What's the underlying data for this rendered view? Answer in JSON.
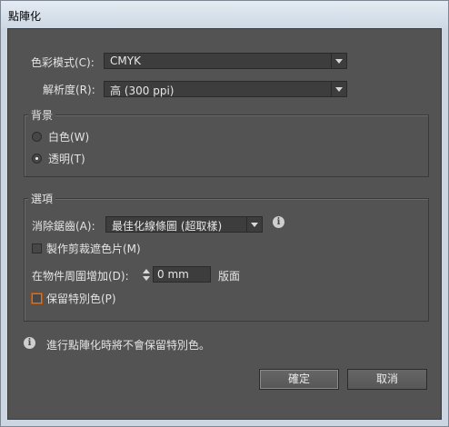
{
  "window": {
    "title": "點陣化"
  },
  "color_mode": {
    "label": "色彩模式(C):",
    "value": "CMYK"
  },
  "resolution": {
    "label": "解析度(R):",
    "value": "高 (300 ppi)"
  },
  "background": {
    "group_title": "背景",
    "options": [
      {
        "label": "白色(W)",
        "selected": false
      },
      {
        "label": "透明(T)",
        "selected": true
      }
    ]
  },
  "options_group": {
    "group_title": "選項",
    "antialias": {
      "label": "消除鋸齒(A):",
      "value": "最佳化線條圖 (超取樣)"
    },
    "clipping_mask": {
      "label": "製作剪裁遮色片(M)",
      "checked": false
    },
    "add_around": {
      "label": "在物件周圍增加(D):",
      "value": "0 mm",
      "unit": "版面"
    },
    "preserve_spot": {
      "label": "保留特別色(P)",
      "checked": false
    }
  },
  "info_message": "進行點陣化時將不會保留特別色。",
  "buttons": {
    "ok": "確定",
    "cancel": "取消"
  },
  "colors": {
    "panel_bg": "#535353",
    "focus_accent": "#d4761e"
  }
}
